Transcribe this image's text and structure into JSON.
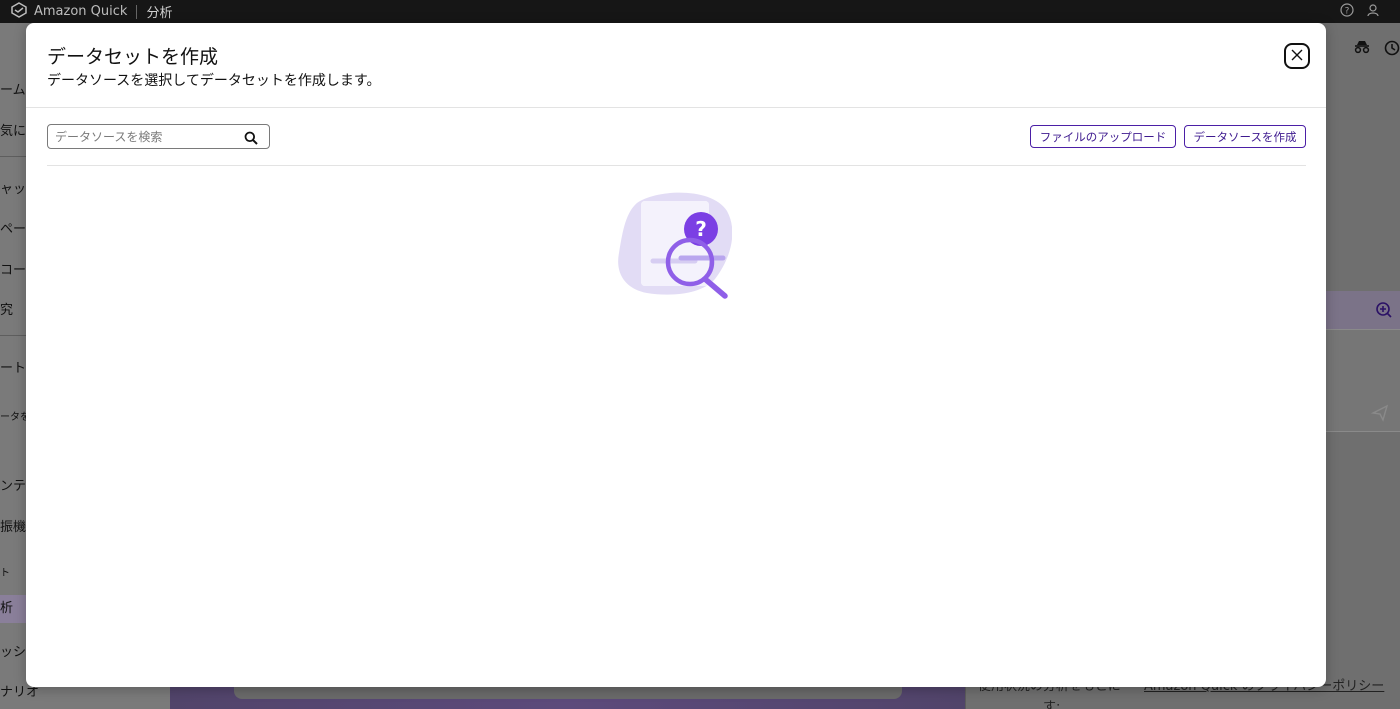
{
  "app": {
    "brand": "Amazon Quick",
    "section": "分析"
  },
  "background": {
    "nav_fragments": [
      "ーム",
      "気に",
      "ャッ",
      "ペー",
      "コー",
      "究",
      "ート",
      "ータを",
      "ンテ",
      "振機",
      "ト",
      "析",
      "ッシ",
      "ナリオ"
    ],
    "footer_text": "便用状況の分析をもとに",
    "footer_link": "Amazon Quick のプライバシーポリシー",
    "footer_tail": "す:"
  },
  "modal": {
    "title": "データセットを作成",
    "subtitle": "データソースを選択してデータセットを作成します。",
    "search": {
      "placeholder": "データソースを検索",
      "value": ""
    },
    "buttons": {
      "upload_label": "ファイルのアップロード",
      "create_source_label": "データソースを作成"
    },
    "empty_state_icon": "search-question-icon"
  },
  "colors": {
    "accent": "#4b1fa6",
    "illustration_light": "#e2dcf5",
    "illustration_dark": "#7b3fe4"
  }
}
